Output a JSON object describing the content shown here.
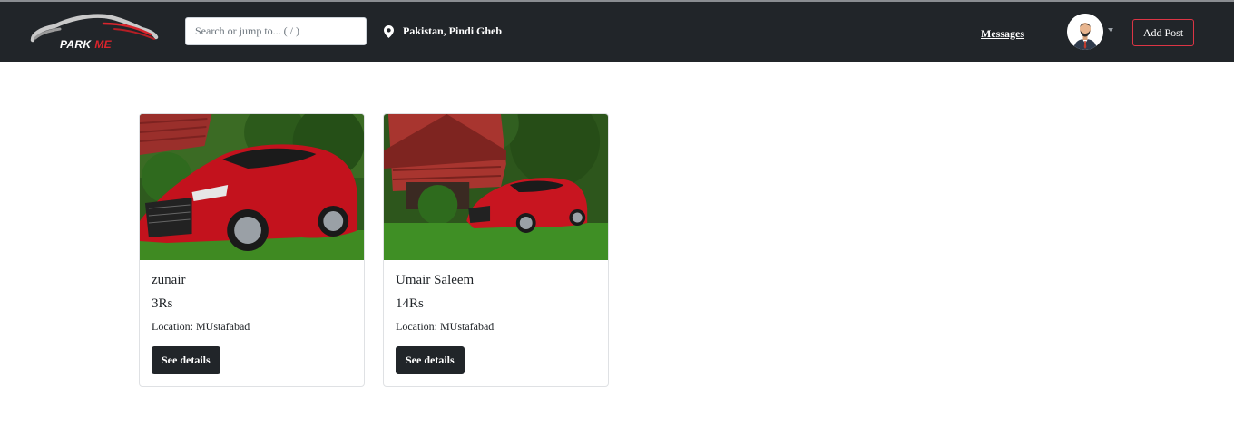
{
  "brand": {
    "logo_text_park": "PARK",
    "logo_text_me": "ME",
    "logo_icon": "car-silhouette-icon",
    "accent_color": "#d9242c"
  },
  "navbar": {
    "background": "#212529",
    "search": {
      "placeholder": "Search or jump to... ( / )",
      "value": ""
    },
    "location": {
      "icon": "map-pin-icon",
      "text": "Pakistan, Pindi Gheb"
    },
    "messages_label": "Messages",
    "avatar_icon": "user-avatar-icon",
    "dropdown_icon": "caret-down-icon",
    "add_post_label": "Add Post",
    "add_post_border_color": "#dc3545"
  },
  "listings": [
    {
      "title": "zunair",
      "price": "3Rs",
      "location": "Location: MUstafabad",
      "button_label": "See details",
      "image": "red-sports-car-photo"
    },
    {
      "title": "Umair Saleem",
      "price": "14Rs",
      "location": "Location: MUstafabad",
      "button_label": "See details",
      "image": "red-sports-car-photo"
    }
  ]
}
